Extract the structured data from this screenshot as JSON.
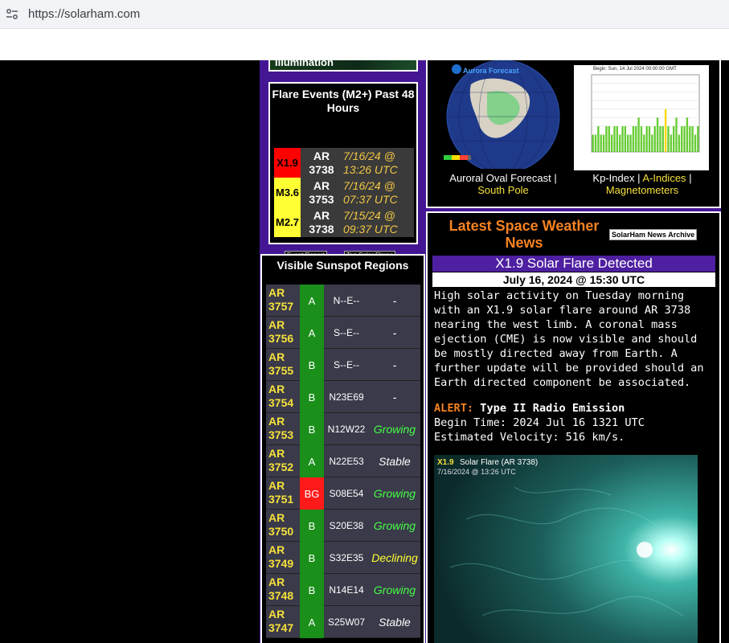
{
  "browser": {
    "url": "https://solarham.com"
  },
  "illumination": {
    "label": "Illumination"
  },
  "flares": {
    "title": "Flare Events (M2+) Past 48 Hours",
    "rows": [
      {
        "cls": "X1.9",
        "ar": "AR 3738",
        "date": "7/16/24 @",
        "time": "13:26 UTC",
        "color": "#ff0000"
      },
      {
        "cls": "M3.6",
        "ar": "AR 3753",
        "date": "7/16/24 @",
        "time": "07:37 UTC",
        "color": "#ffff33"
      },
      {
        "cls": "M2.7",
        "ar": "AR 3738",
        "date": "7/15/24 @",
        "time": "09:37 UTC",
        "color": "#ffff33"
      }
    ],
    "btn_event": "Event Report",
    "btn_top": "Top Solar Flares"
  },
  "sunspots": {
    "title": "Visible Sunspot Regions",
    "rows": [
      {
        "ar": "AR 3757",
        "mag": "A",
        "loc": "N--E--",
        "trend": "-",
        "mag_color": "#1a8f1a",
        "trend_color": "#ffffff"
      },
      {
        "ar": "AR 3756",
        "mag": "A",
        "loc": "S--E--",
        "trend": "-",
        "mag_color": "#1a8f1a",
        "trend_color": "#ffffff"
      },
      {
        "ar": "AR 3755",
        "mag": "B",
        "loc": "S--E--",
        "trend": "-",
        "mag_color": "#1a8f1a",
        "trend_color": "#ffffff"
      },
      {
        "ar": "AR 3754",
        "mag": "B",
        "loc": "N23E69",
        "trend": "-",
        "mag_color": "#1a8f1a",
        "trend_color": "#ffffff"
      },
      {
        "ar": "AR 3753",
        "mag": "B",
        "loc": "N12W22",
        "trend": "Growing",
        "mag_color": "#1a8f1a",
        "trend_color": "#44ff44"
      },
      {
        "ar": "AR 3752",
        "mag": "A",
        "loc": "N22E53",
        "trend": "Stable",
        "mag_color": "#1a8f1a",
        "trend_color": "#ffffff"
      },
      {
        "ar": "AR 3751",
        "mag": "BG",
        "loc": "S08E54",
        "trend": "Growing",
        "mag_color": "#ff1a1a",
        "trend_color": "#44ff44"
      },
      {
        "ar": "AR 3750",
        "mag": "B",
        "loc": "S20E38",
        "trend": "Growing",
        "mag_color": "#1a8f1a",
        "trend_color": "#44ff44"
      },
      {
        "ar": "AR 3749",
        "mag": "B",
        "loc": "S32E35",
        "trend": "Declining",
        "mag_color": "#1a8f1a",
        "trend_color": "#ffff33"
      },
      {
        "ar": "AR 3748",
        "mag": "B",
        "loc": "N14E14",
        "trend": "Growing",
        "mag_color": "#1a8f1a",
        "trend_color": "#44ff44"
      },
      {
        "ar": "AR 3747",
        "mag": "A",
        "loc": "S25W07",
        "trend": "Stable",
        "mag_color": "#1a8f1a",
        "trend_color": "#ffffff"
      }
    ]
  },
  "forecast": {
    "aurora_title": "Aurora Forecast",
    "aurora_caption": "Auroral Oval Forecast |",
    "aurora_link": "South Pole",
    "kp_begin": "Begin: Sun, 14 Jul 2024 00:00:00 GMT",
    "kp_caption": "Kp-Index |",
    "kp_link1": "A-Indices",
    "kp_sep": "|",
    "kp_link2": "Magnetometers",
    "kp_values": [
      2,
      2,
      3,
      2,
      2,
      3,
      3,
      2,
      3,
      3,
      2,
      3,
      3,
      2,
      2,
      3,
      3,
      4,
      3,
      2,
      3,
      3,
      2,
      3,
      4,
      3,
      3,
      5,
      3,
      2,
      3,
      4,
      2,
      3,
      3,
      4,
      3,
      3,
      2,
      3
    ]
  },
  "news": {
    "title": "Latest Space Weather News",
    "archive": "SolarHam News Archive",
    "headline": "X1.9 Solar Flare Detected",
    "date": "July 16, 2024 @ 15:30 UTC",
    "body": "High solar activity on Tuesday morning with an X1.9 solar flare around AR 3738 nearing the west limb. A coronal mass ejection (CME) is now visible and should be mostly directed away from Earth. A further update will be provided should an Earth directed component be associated.",
    "alert_label": "ALERT:",
    "alert_type": "Type II Radio Emission",
    "begin_time": "Begin Time: 2024 Jul 16 1321 UTC",
    "velocity": "Estimated Velocity: 516 km/s.",
    "img_class": "X1.9",
    "img_label": "Solar Flare (AR 3738)",
    "img_time": "7/16/2024 @ 13:26 UTC"
  }
}
